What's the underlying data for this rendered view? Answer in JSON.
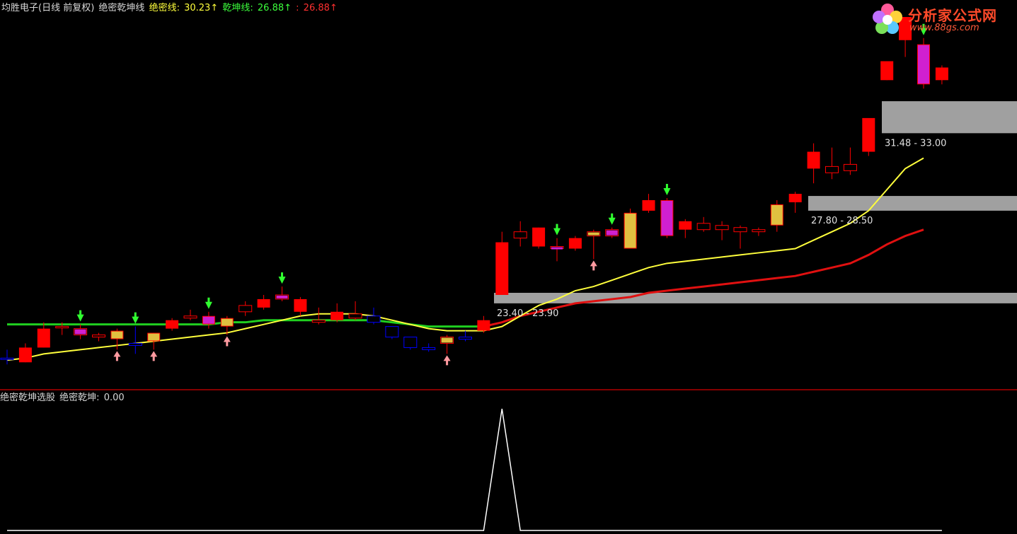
{
  "header": {
    "stock_title": "均胜电子(日线 前复权)",
    "indicator_name": "绝密乾坤线",
    "jue_mi_label": "绝密线:",
    "jue_mi_value": "30.23↑",
    "qian_kun_label": "乾坤线:",
    "qian_kun_value": "26.88↑",
    "extra_label": ":",
    "extra_value": "26.88↑"
  },
  "sub_header": {
    "panel_title": "绝密乾坤选股",
    "value_label": "绝密乾坤:",
    "value": "0.00"
  },
  "logo": {
    "brand": "分析家公式网",
    "url": "www.88gs.com"
  },
  "colors": {
    "background": "#000000",
    "up_candle": "#ff0000",
    "down_candle": "#0000ff",
    "jue_mi_line": "#ffff3c",
    "qian_kun_line_red": "#e01010",
    "qian_kun_line_green": "#20d020",
    "zone_fill": "#a0a0a0",
    "panel_divider": "#b00000",
    "signal_line": "#ffffff",
    "magenta_highlight": "#d020d0",
    "gold_highlight": "#e0c040"
  },
  "chart_data": [
    {
      "type": "candlestick",
      "title": "均胜电子(日线 前复权) 绝密乾坤线",
      "ylim": [
        19.5,
        37.0
      ],
      "candles": [
        {
          "o": 20.8,
          "h": 21.2,
          "l": 20.5,
          "c": 20.8,
          "up": false
        },
        {
          "o": 20.6,
          "h": 21.5,
          "l": 20.6,
          "c": 21.3,
          "up": true
        },
        {
          "o": 21.3,
          "h": 22.5,
          "l": 21.3,
          "c": 22.2,
          "up": true
        },
        {
          "o": 22.3,
          "h": 22.5,
          "l": 21.9,
          "c": 22.3,
          "up": true
        },
        {
          "o": 21.9,
          "h": 22.4,
          "l": 21.7,
          "c": 22.2,
          "up": true,
          "hl": "magenta",
          "arrow_down": true
        },
        {
          "o": 21.8,
          "h": 22.0,
          "l": 21.6,
          "c": 21.9,
          "up": true
        },
        {
          "o": 21.7,
          "h": 22.2,
          "l": 21.2,
          "c": 22.1,
          "up": true,
          "hl": "gold",
          "arrow_up": true
        },
        {
          "o": 21.5,
          "h": 22.3,
          "l": 21.0,
          "c": 21.4,
          "up": false,
          "arrow_down": true
        },
        {
          "o": 21.6,
          "h": 22.0,
          "l": 21.2,
          "c": 22.0,
          "up": true,
          "hl": "gold",
          "arrow_up": true
        },
        {
          "o": 22.2,
          "h": 22.7,
          "l": 22.1,
          "c": 22.6,
          "up": true
        },
        {
          "o": 22.7,
          "h": 23.1,
          "l": 22.6,
          "c": 22.8,
          "up": true
        },
        {
          "o": 22.4,
          "h": 23.0,
          "l": 22.2,
          "c": 22.8,
          "up": true,
          "hl": "magenta",
          "arrow_down": true
        },
        {
          "o": 22.3,
          "h": 22.8,
          "l": 21.9,
          "c": 22.7,
          "up": true,
          "hl": "gold",
          "arrow_up": true
        },
        {
          "o": 23.0,
          "h": 23.5,
          "l": 22.8,
          "c": 23.3,
          "up": true
        },
        {
          "o": 23.2,
          "h": 23.8,
          "l": 23.1,
          "c": 23.6,
          "up": true
        },
        {
          "o": 23.6,
          "h": 24.2,
          "l": 23.5,
          "c": 23.8,
          "up": true,
          "hl": "magenta",
          "arrow_down": true
        },
        {
          "o": 23.0,
          "h": 23.7,
          "l": 22.8,
          "c": 23.6,
          "up": true
        },
        {
          "o": 22.5,
          "h": 23.2,
          "l": 22.4,
          "c": 22.6,
          "up": true
        },
        {
          "o": 22.6,
          "h": 23.4,
          "l": 22.5,
          "c": 23.0,
          "up": true
        },
        {
          "o": 22.7,
          "h": 23.5,
          "l": 22.6,
          "c": 22.9,
          "up": true
        },
        {
          "o": 22.8,
          "h": 23.2,
          "l": 22.4,
          "c": 22.5,
          "up": false
        },
        {
          "o": 22.3,
          "h": 22.3,
          "l": 21.7,
          "c": 21.8,
          "up": false
        },
        {
          "o": 21.8,
          "h": 21.8,
          "l": 21.2,
          "c": 21.3,
          "up": false
        },
        {
          "o": 21.3,
          "h": 21.5,
          "l": 21.1,
          "c": 21.2,
          "up": false
        },
        {
          "o": 21.5,
          "h": 21.9,
          "l": 21.0,
          "c": 21.8,
          "up": true,
          "hl": "gold",
          "arrow_up": true
        },
        {
          "o": 21.7,
          "h": 22.1,
          "l": 21.6,
          "c": 21.8,
          "up": false
        },
        {
          "o": 22.1,
          "h": 22.8,
          "l": 22.0,
          "c": 22.6,
          "up": true
        },
        {
          "o": 23.8,
          "h": 26.8,
          "l": 23.8,
          "c": 26.3,
          "up": true
        },
        {
          "o": 26.5,
          "h": 27.3,
          "l": 26.1,
          "c": 26.8,
          "up": true
        },
        {
          "o": 26.1,
          "h": 27.0,
          "l": 26.0,
          "c": 27.0,
          "up": true
        },
        {
          "o": 26.0,
          "h": 26.5,
          "l": 25.4,
          "c": 26.1,
          "up": true,
          "hl": "magenta",
          "arrow_down": true
        },
        {
          "o": 26.0,
          "h": 26.6,
          "l": 25.9,
          "c": 26.5,
          "up": true
        },
        {
          "o": 26.6,
          "h": 26.9,
          "l": 25.5,
          "c": 26.8,
          "up": true,
          "hl": "gold",
          "arrow_up": true
        },
        {
          "o": 26.6,
          "h": 27.0,
          "l": 26.5,
          "c": 26.9,
          "up": true,
          "hl": "magenta",
          "arrow_down": true
        },
        {
          "o": 26.0,
          "h": 27.9,
          "l": 26.0,
          "c": 27.7,
          "up": true,
          "hl": "gold"
        },
        {
          "o": 27.8,
          "h": 28.6,
          "l": 27.7,
          "c": 28.3,
          "up": true
        },
        {
          "o": 26.6,
          "h": 28.4,
          "l": 26.5,
          "c": 28.3,
          "up": true,
          "hl": "magenta",
          "arrow_down": true
        },
        {
          "o": 26.9,
          "h": 27.4,
          "l": 26.5,
          "c": 27.3,
          "up": true
        },
        {
          "o": 26.9,
          "h": 27.5,
          "l": 26.8,
          "c": 27.2,
          "up": true
        },
        {
          "o": 26.9,
          "h": 27.3,
          "l": 26.4,
          "c": 27.1,
          "up": true
        },
        {
          "o": 26.8,
          "h": 27.1,
          "l": 26.0,
          "c": 27.0,
          "up": true
        },
        {
          "o": 26.8,
          "h": 27.0,
          "l": 26.6,
          "c": 26.9,
          "up": true
        },
        {
          "o": 27.1,
          "h": 28.3,
          "l": 26.8,
          "c": 28.1,
          "up": true,
          "hl": "gold"
        },
        {
          "o": 28.2,
          "h": 28.7,
          "l": 27.7,
          "c": 28.6,
          "up": true
        },
        {
          "o": 29.8,
          "h": 31.0,
          "l": 29.1,
          "c": 30.6,
          "up": true
        },
        {
          "o": 29.6,
          "h": 30.8,
          "l": 29.3,
          "c": 29.9,
          "up": true
        },
        {
          "o": 29.7,
          "h": 30.8,
          "l": 29.5,
          "c": 30.0,
          "up": true
        },
        {
          "o": 30.6,
          "h": 31.5,
          "l": 30.4,
          "c": 32.2,
          "up": true
        },
        {
          "o": 34.0,
          "h": 34.9,
          "l": 34.0,
          "c": 34.9,
          "up": true
        },
        {
          "o": 35.9,
          "h": 37.0,
          "l": 35.1,
          "c": 37.0,
          "up": true
        },
        {
          "o": 33.8,
          "h": 36.0,
          "l": 33.6,
          "c": 35.7,
          "up": true,
          "hl": "magenta",
          "arrow_down": true
        },
        {
          "o": 34.0,
          "h": 34.7,
          "l": 33.8,
          "c": 34.6,
          "up": true
        }
      ],
      "jue_mi_line": [
        20.7,
        20.8,
        21.0,
        21.1,
        21.2,
        21.3,
        21.4,
        21.5,
        21.6,
        21.7,
        21.8,
        21.9,
        22.0,
        22.2,
        22.4,
        22.6,
        22.8,
        22.9,
        22.9,
        22.9,
        22.8,
        22.6,
        22.4,
        22.2,
        22.1,
        22.1,
        22.1,
        22.3,
        22.8,
        23.3,
        23.6,
        24.0,
        24.2,
        24.5,
        24.8,
        25.1,
        25.3,
        25.4,
        25.5,
        25.6,
        25.7,
        25.8,
        25.9,
        26.0,
        26.4,
        26.8,
        27.2,
        27.8,
        28.8,
        29.8,
        30.3
      ],
      "qian_kun_line": [
        22.4,
        22.4,
        22.4,
        22.4,
        22.4,
        22.4,
        22.4,
        22.4,
        22.4,
        22.4,
        22.4,
        22.4,
        22.5,
        22.5,
        22.6,
        22.6,
        22.6,
        22.6,
        22.6,
        22.6,
        22.6,
        22.5,
        22.4,
        22.3,
        22.3,
        22.3,
        22.3,
        22.5,
        22.8,
        23.0,
        23.2,
        23.4,
        23.5,
        23.6,
        23.7,
        23.9,
        24.0,
        24.1,
        24.2,
        24.3,
        24.4,
        24.5,
        24.6,
        24.7,
        24.9,
        25.1,
        25.3,
        25.7,
        26.2,
        26.6,
        26.9
      ],
      "qian_kun_green_until_index": 26,
      "zones": [
        {
          "low": 23.4,
          "high": 23.9,
          "label": "23.40 - 23.90"
        },
        {
          "low": 27.8,
          "high": 28.5,
          "label": "27.80 - 28.50"
        },
        {
          "low": 31.48,
          "high": 33.0,
          "label": "31.48 - 33.00"
        }
      ]
    },
    {
      "type": "line",
      "title": "绝密乾坤选股",
      "series": [
        {
          "name": "绝密乾坤",
          "values": [
            0,
            0,
            0,
            0,
            0,
            0,
            0,
            0,
            0,
            0,
            0,
            0,
            0,
            0,
            0,
            0,
            0,
            0,
            0,
            0,
            0,
            0,
            0,
            0,
            0,
            0,
            0,
            1,
            0,
            0,
            0,
            0,
            0,
            0,
            0,
            0,
            0,
            0,
            0,
            0,
            0,
            0,
            0,
            0,
            0,
            0,
            0,
            0,
            0,
            0,
            0,
            0
          ]
        }
      ],
      "ylim": [
        0,
        1
      ]
    }
  ]
}
